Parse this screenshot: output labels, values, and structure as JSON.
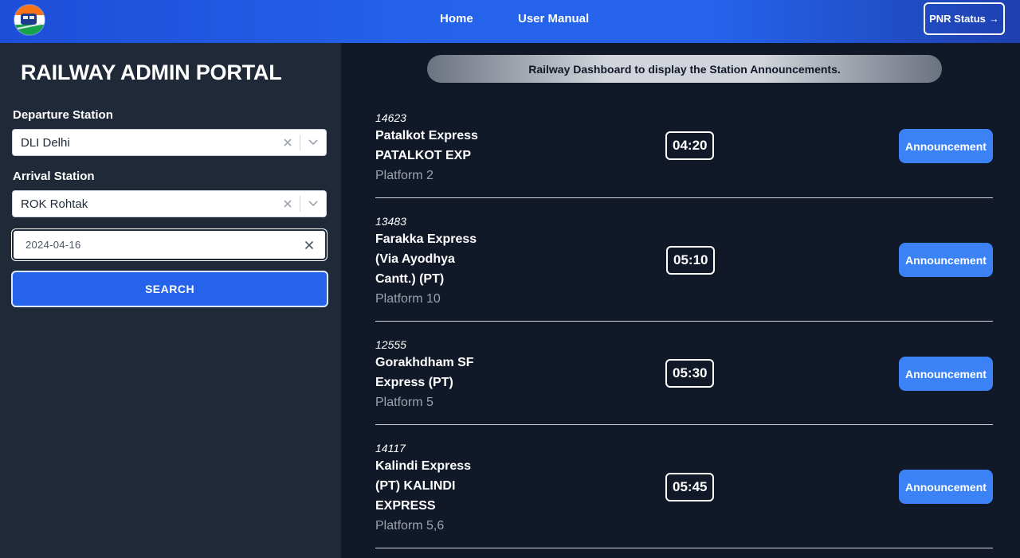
{
  "header": {
    "logo_icon": "railway-train-logo",
    "nav": [
      {
        "label": "Home"
      },
      {
        "label": "User Manual"
      }
    ],
    "pnr_label": "PNR Status",
    "pnr_arrow": "→"
  },
  "sidebar": {
    "title": "RAILWAY ADMIN PORTAL",
    "departure": {
      "label": "Departure Station",
      "value": "DLI Delhi"
    },
    "arrival": {
      "label": "Arrival Station",
      "value": "ROK Rohtak"
    },
    "date": {
      "value": "2024-04-16"
    },
    "search_label": "SEARCH"
  },
  "main": {
    "banner": "Railway Dashboard to display the Station Announcements.",
    "trains": [
      {
        "number": "14623",
        "name": "Patalkot Express PATALKOT EXP",
        "platform": "Platform 2",
        "time": "04:20",
        "button": "Announcement"
      },
      {
        "number": "13483",
        "name": "Farakka Express (Via Ayodhya Cantt.) (PT)",
        "platform": "Platform 10",
        "time": "05:10",
        "button": "Announcement"
      },
      {
        "number": "12555",
        "name": "Gorakhdham SF Express (PT)",
        "platform": "Platform 5",
        "time": "05:30",
        "button": "Announcement"
      },
      {
        "number": "14117",
        "name": "Kalindi Express (PT) KALINDI EXPRESS",
        "platform": "Platform 5,6",
        "time": "05:45",
        "button": "Announcement"
      }
    ]
  },
  "colors": {
    "header_blue": "#2563eb",
    "sidebar_bg": "#1f2937",
    "main_bg": "#111827",
    "button_blue": "#3b82f6"
  }
}
